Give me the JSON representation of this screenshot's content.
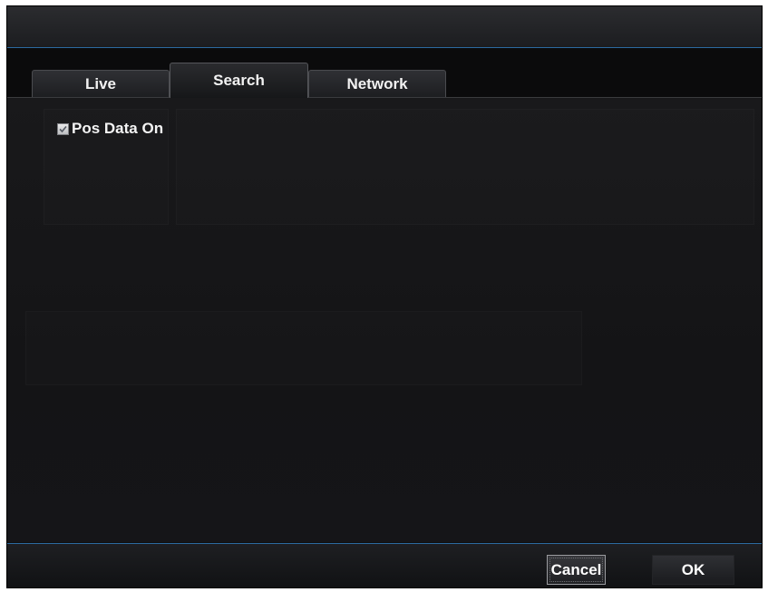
{
  "tabs": [
    {
      "label": "Live",
      "active": false
    },
    {
      "label": "Search",
      "active": true
    },
    {
      "label": "Network",
      "active": false
    }
  ],
  "search_tab": {
    "pos_data_checkbox": {
      "label": "Pos Data On",
      "checked": true
    }
  },
  "footer": {
    "cancel_label": "Cancel",
    "ok_label": "OK"
  },
  "colors": {
    "background": "#141416",
    "accent_line": "#2c6aa0",
    "text": "#f4f4f4"
  }
}
